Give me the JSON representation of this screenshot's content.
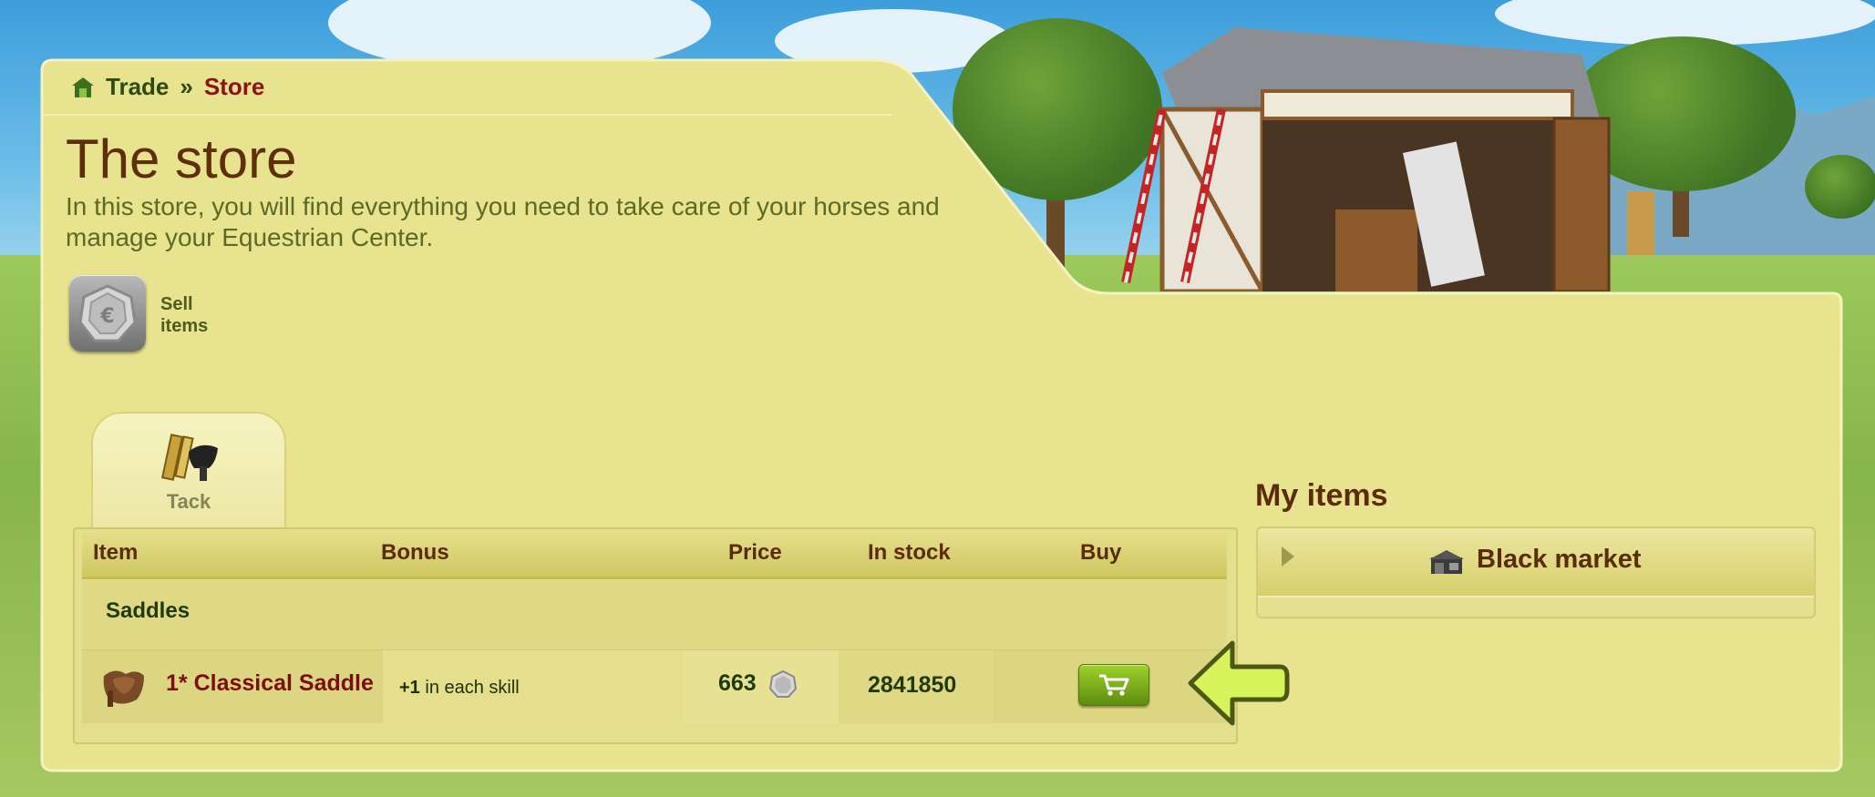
{
  "breadcrumb": {
    "parent": "Trade",
    "separator": "»",
    "current": "Store"
  },
  "page": {
    "title": "The store",
    "subtitle": "In this store, you will find everything you need to take care of your horses and manage your Equestrian Center."
  },
  "sell": {
    "label": "Sell items"
  },
  "tabs": [
    {
      "label": "Tack",
      "icon": "tack-icon",
      "selected": true
    }
  ],
  "table": {
    "headers": {
      "item": "Item",
      "bonus": "Bonus",
      "price": "Price",
      "stock": "In stock",
      "buy": "Buy"
    },
    "groups": [
      {
        "label": "Saddles",
        "rows": [
          {
            "name": "1* Classical Saddle",
            "bonus_value": "+1",
            "bonus_text": "in each skill",
            "price": "663",
            "currency_icon": "equus-coin-icon",
            "stock": "2841850",
            "buy_icon": "cart-icon"
          }
        ]
      }
    ]
  },
  "my_items": {
    "title": "My items",
    "sections": [
      {
        "label": "Black market",
        "icon": "black-market-icon"
      }
    ]
  },
  "colors": {
    "panel": "#e8e38e",
    "title": "#5e2f0b",
    "link_red": "#8a1414",
    "buy_green": "#7fb01e",
    "arrow": "#d8f25a"
  }
}
